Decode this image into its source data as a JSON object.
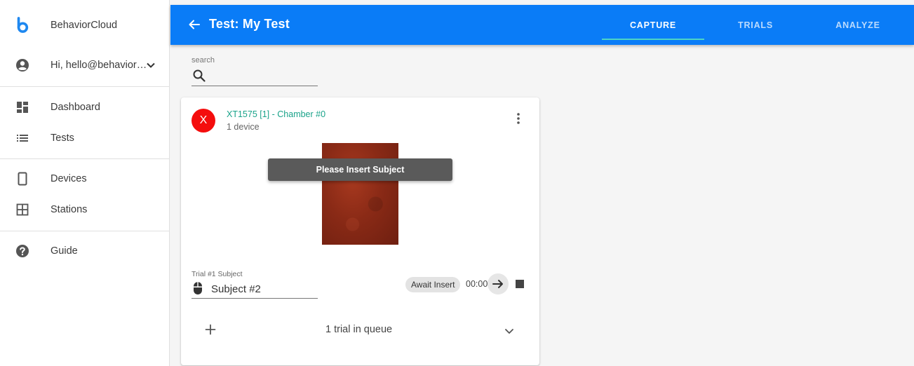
{
  "app": {
    "name": "BehaviorCloud",
    "brand_color": "#0a7cf7",
    "accent_color": "#4dd4c5"
  },
  "sidebar": {
    "user_greeting": "Hi, hello@behavior…",
    "items": [
      {
        "label": "Dashboard",
        "icon": "dashboard-icon"
      },
      {
        "label": "Tests",
        "icon": "list-icon"
      },
      {
        "label": "Devices",
        "icon": "device-icon"
      },
      {
        "label": "Stations",
        "icon": "grid-icon"
      },
      {
        "label": "Guide",
        "icon": "help-icon"
      }
    ]
  },
  "header": {
    "title": "Test: My Test",
    "tabs": [
      {
        "label": "CAPTURE",
        "active": true
      },
      {
        "label": "TRIALS",
        "active": false
      },
      {
        "label": "ANALYZE",
        "active": false
      }
    ]
  },
  "search": {
    "label": "search",
    "value": "",
    "placeholder": ""
  },
  "card": {
    "avatar_letter": "X",
    "avatar_color": "#f40d0d",
    "title": "XT1575 [1] - Chamber #0",
    "title_color": "#1aa38a",
    "subtitle": "1 device",
    "toast": "Please Insert Subject",
    "trial_label": "Trial #1 Subject",
    "subject": "Subject #2",
    "status": "Await Insert",
    "timer": "00:00",
    "queue_text": "1 trial in queue"
  }
}
